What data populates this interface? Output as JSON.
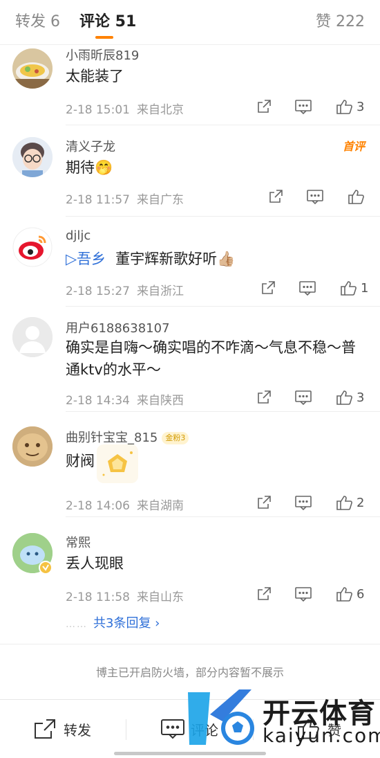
{
  "tabs": {
    "repost": "转发 6",
    "comment": "评论 51",
    "like": "赞 222"
  },
  "comments": [
    {
      "user": "小雨昕辰819",
      "text": "太能装了",
      "time": "2-18 15:01",
      "loc": "来自北京",
      "likes": "3"
    },
    {
      "user": "清义子龙",
      "text": "期待🤭",
      "time": "2-18 11:57",
      "loc": "来自广东",
      "likes": "",
      "badge": "首评"
    },
    {
      "user": "djljc",
      "text_link": "▷吾乡",
      "text": "董宇辉新歌好听👍🏼",
      "time": "2-18 15:27",
      "loc": "来自浙江",
      "likes": "1"
    },
    {
      "user": "用户6188638107",
      "text": "确实是自嗨～确实唱的不咋滴～气息不稳～普通ktv的水平～",
      "time": "2-18 14:34",
      "loc": "来自陕西",
      "likes": "3"
    },
    {
      "user": "曲别针宝宝_815",
      "level": "金粉3",
      "text": "财阀",
      "time": "2-18 14:06",
      "loc": "来自湖南",
      "likes": "2"
    },
    {
      "user": "常熙",
      "text": "丢人现眼",
      "time": "2-18 11:58",
      "loc": "来自山东",
      "likes": "6",
      "replies": "共3条回复 ›"
    }
  ],
  "firewall_notice": "博主已开启防火墙，部分内容暂不展示",
  "toolbar": {
    "repost": "转发",
    "comment": "评论",
    "like": "赞"
  },
  "watermark": {
    "brand": "开云体育",
    "domain": "kaiyun.com"
  },
  "colors": {
    "accent": "#ff8200",
    "link": "#2e6fd8",
    "meta": "#999999"
  }
}
